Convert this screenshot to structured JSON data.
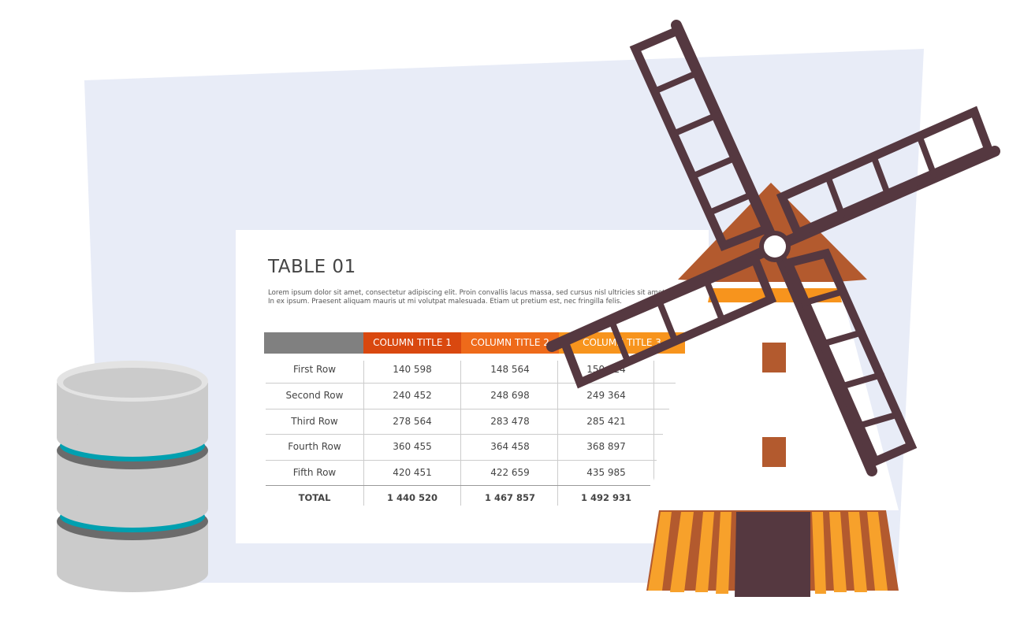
{
  "table": {
    "title": "TABLE 01",
    "description": [
      "Lorem ipsum dolor sit amet, consectetur adipiscing elit. Proin convallis lacus massa, sed cursus nisl ultricies sit amet. Ut",
      "In ex ipsum. Praesent aliquam mauris ut mi volutpat malesuada. Etiam ut pretium est, nec fringilla felis."
    ],
    "columns": [
      "",
      "COLUMN TITLE 1",
      "COLUMN TITLE 2",
      "COLUMN TITLE 3"
    ],
    "rows": [
      {
        "label": "First Row",
        "values": [
          "140 598",
          "148 564",
          "150 124"
        ]
      },
      {
        "label": "Second Row",
        "values": [
          "240 452",
          "248 698",
          "249 364"
        ]
      },
      {
        "label": "Third Row",
        "values": [
          "278 564",
          "283 478",
          "285 421"
        ]
      },
      {
        "label": "Fourth Row",
        "values": [
          "360 455",
          "364 458",
          "368 897"
        ]
      },
      {
        "label": "Fifth Row",
        "values": [
          "420 451",
          "422 659",
          "435 985"
        ]
      }
    ],
    "total": {
      "label": "TOTAL",
      "values": [
        "1 440 520",
        "1 467 857",
        "1 492 931"
      ]
    }
  },
  "colors": {
    "backdrop": "#e8ecf7",
    "header_gray": "#808080",
    "header_col1": "#d9480f",
    "header_col2": "#ee6a1a",
    "header_col3": "#f7941d",
    "db_body": "#cbcbcb",
    "db_top": "#e3e3e3",
    "db_band": "#00a0b0",
    "db_dark": "#6b6b6b",
    "windmill_blades": "#553840",
    "windmill_roof": "#b35a2e",
    "windmill_band": "#f7941d",
    "windmill_base_stripe": "#f7a12b",
    "windmill_door": "#553840"
  },
  "icons": [
    "database-icon",
    "windmill-illustration"
  ]
}
